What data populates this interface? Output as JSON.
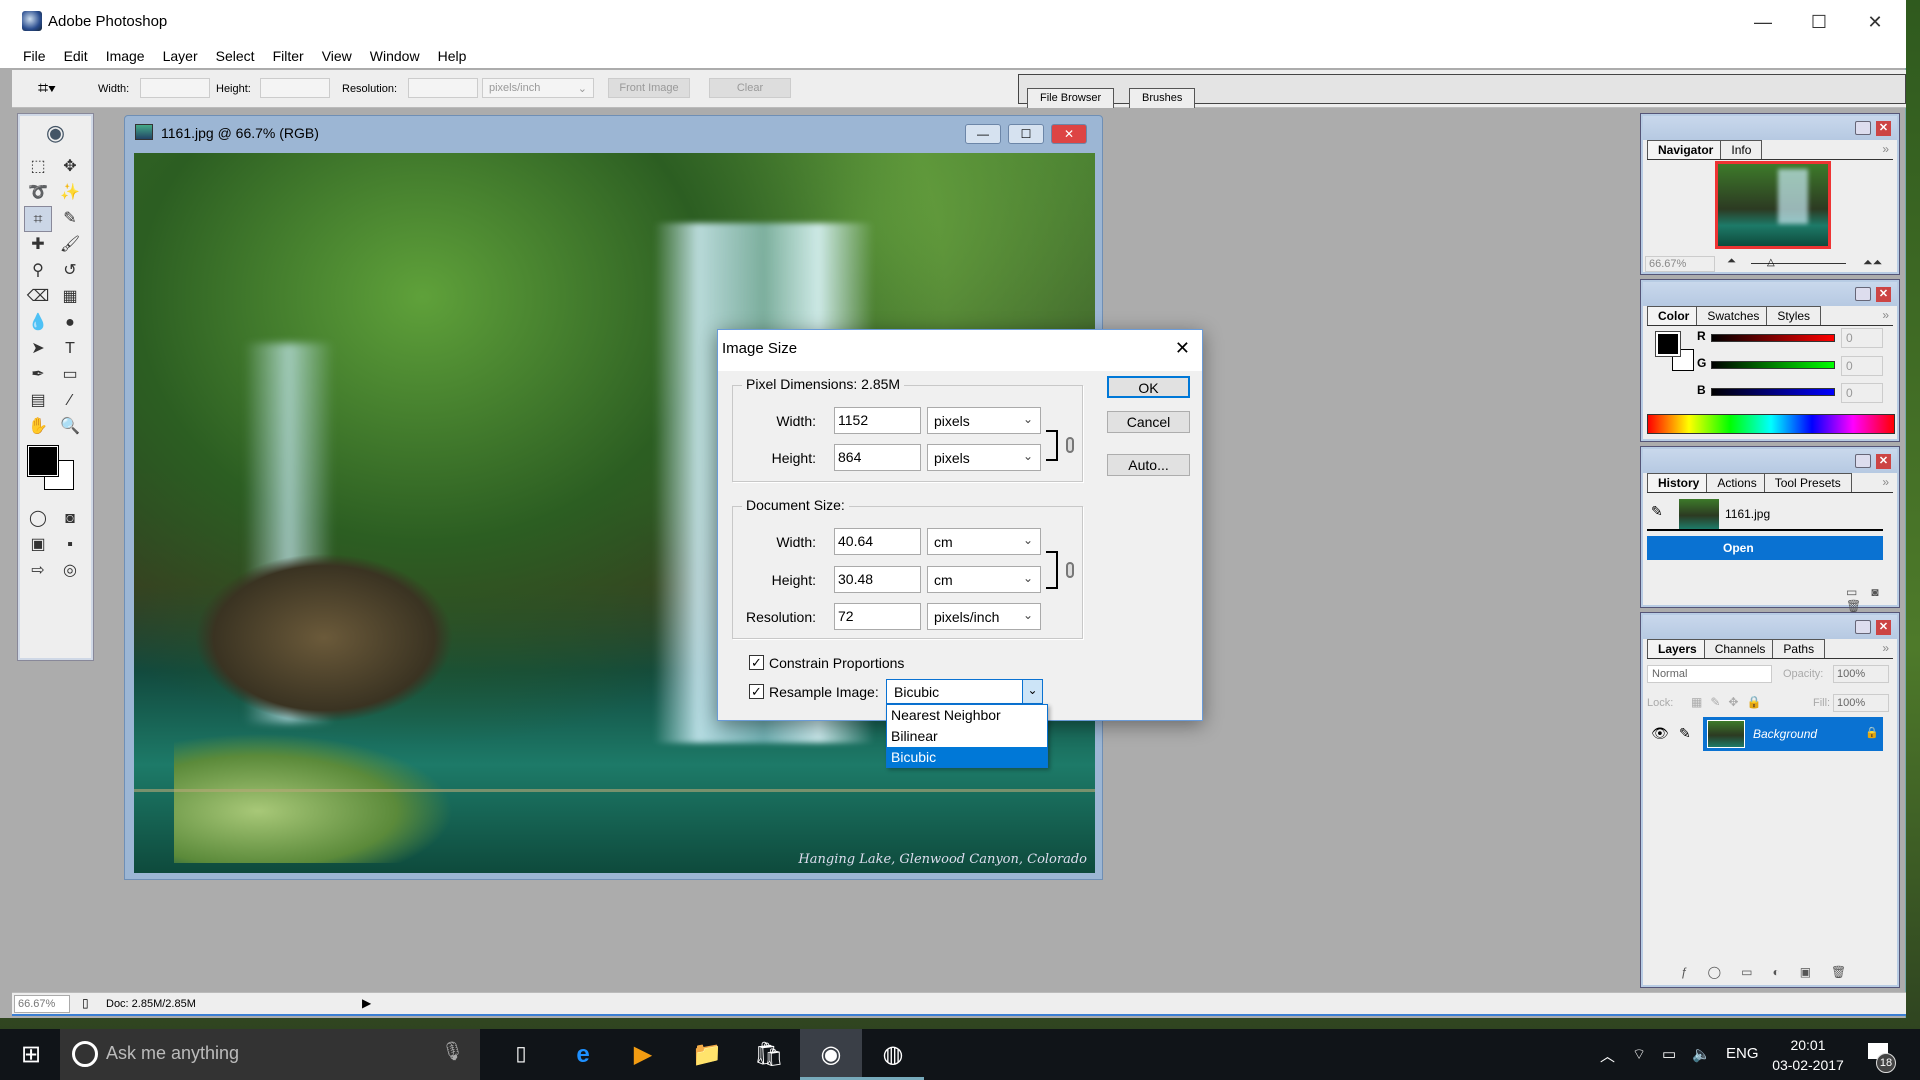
{
  "app": {
    "title": "Adobe Photoshop"
  },
  "menu": [
    "File",
    "Edit",
    "Image",
    "Layer",
    "Select",
    "Filter",
    "View",
    "Window",
    "Help"
  ],
  "options": {
    "width_label": "Width:",
    "height_label": "Height:",
    "resolution_label": "Resolution:",
    "resolution_unit": "pixels/inch",
    "front_image": "Front Image",
    "clear": "Clear",
    "tabs": [
      "File Browser",
      "Brushes"
    ]
  },
  "document": {
    "title": "1161.jpg @ 66.7% (RGB)",
    "caption": "Hanging Lake, Glenwood Canyon, Colorado"
  },
  "dialog": {
    "title": "Image Size",
    "pixel_dimensions": {
      "label": "Pixel Dimensions:",
      "size": "2.85M",
      "width_label": "Width:",
      "width": "1152",
      "width_unit": "pixels",
      "height_label": "Height:",
      "height": "864",
      "height_unit": "pixels"
    },
    "document_size": {
      "label": "Document Size:",
      "width_label": "Width:",
      "width": "40.64",
      "width_unit": "cm",
      "height_label": "Height:",
      "height": "30.48",
      "height_unit": "cm",
      "resolution_label": "Resolution:",
      "resolution": "72",
      "resolution_unit": "pixels/inch"
    },
    "constrain": {
      "label": "Constrain Proportions",
      "checked": true
    },
    "resample": {
      "label": "Resample Image:",
      "checked": true,
      "value": "Bicubic",
      "options": [
        "Nearest Neighbor",
        "Bilinear",
        "Bicubic"
      ]
    },
    "buttons": {
      "ok": "OK",
      "cancel": "Cancel",
      "auto": "Auto..."
    }
  },
  "panels": {
    "navigator": {
      "tabs": [
        "Navigator",
        "Info"
      ],
      "zoom": "66.67%"
    },
    "color": {
      "tabs": [
        "Color",
        "Swatches",
        "Styles"
      ],
      "r_label": "R",
      "g_label": "G",
      "b_label": "B",
      "r": "0",
      "g": "0",
      "b": "0"
    },
    "history": {
      "tabs": [
        "History",
        "Actions",
        "Tool Presets"
      ],
      "snapshot": "1161.jpg",
      "items": [
        "Open"
      ]
    },
    "layers": {
      "tabs": [
        "Layers",
        "Channels",
        "Paths"
      ],
      "mode": "Normal",
      "opacity_label": "Opacity:",
      "opacity": "100%",
      "lock_label": "Lock:",
      "fill_label": "Fill:",
      "fill": "100%",
      "layer": "Background"
    }
  },
  "status": {
    "zoom": "66.67%",
    "doc": "Doc: 2.85M/2.85M"
  },
  "taskbar": {
    "search_placeholder": "Ask me anything",
    "lang": "ENG",
    "time": "20:01",
    "date": "03-02-2017",
    "notifications": "18"
  }
}
